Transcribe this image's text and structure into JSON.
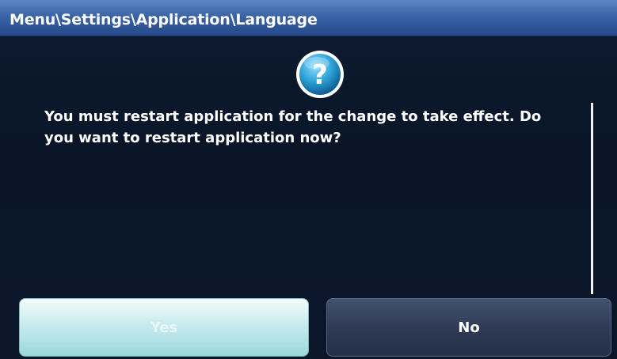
{
  "titlebar": {
    "path": "Menu\\Settings\\Application\\Language"
  },
  "dialog": {
    "icon": "question-icon",
    "message": "You must restart application for the change to take effect. Do you want to restart application now?"
  },
  "buttons": {
    "yes_label": "Yes",
    "no_label": "No"
  },
  "colors": {
    "titlebar": "#3a64a6",
    "background": "#0a1628",
    "yes_button": "#c9ebef",
    "no_button": "#2f3b56",
    "icon_accent": "#2ea3d8"
  }
}
